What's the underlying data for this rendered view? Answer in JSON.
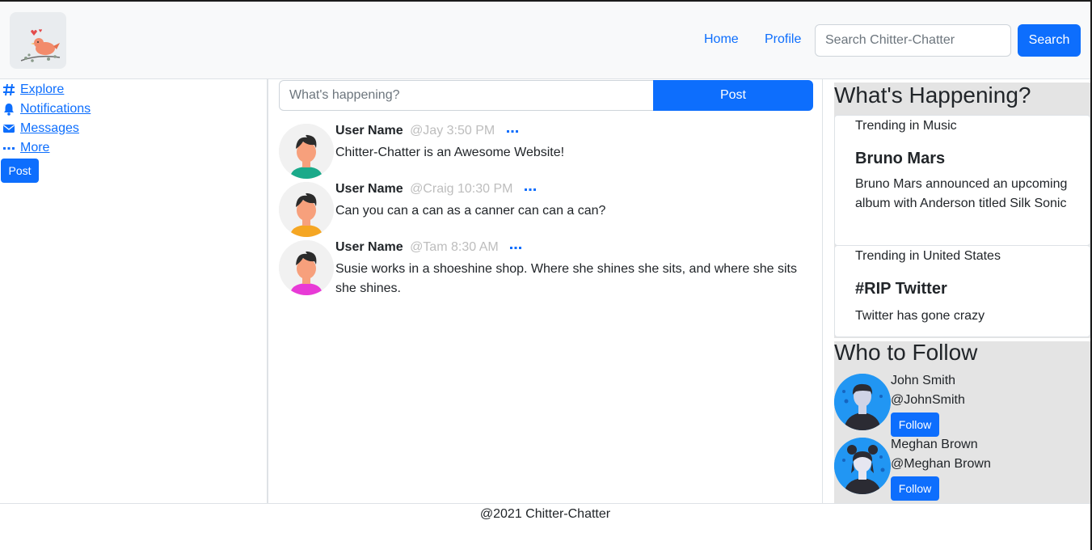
{
  "navbar": {
    "logo_icon": "bird-logo-icon",
    "links": [
      "Home",
      "Profile"
    ],
    "search_placeholder": "Search Chitter-Chatter",
    "search_button": "Search"
  },
  "sidebar": {
    "items": [
      {
        "label": "Explore",
        "icon": "hashtag-icon"
      },
      {
        "label": "Notifications",
        "icon": "bell-icon"
      },
      {
        "label": "Messages",
        "icon": "envelope-icon"
      },
      {
        "label": "More",
        "icon": "dots-icon"
      }
    ],
    "post_button": "Post"
  },
  "compose": {
    "placeholder": "What's happening?",
    "post_button": "Post"
  },
  "feed": [
    {
      "name": "User Name",
      "handle": "@Jay",
      "time": "3:50 PM",
      "text": "Chitter-Chatter is an Awesome Website!",
      "shirt_color": "#1aaa8a"
    },
    {
      "name": "User Name",
      "handle": "@Craig",
      "time": "10:30 PM",
      "text": "Can you can a can as a canner can can a can?",
      "shirt_color": "#f5a623"
    },
    {
      "name": "User Name",
      "handle": "@Tam",
      "time": "8:30 AM",
      "text": "Susie works in a shoeshine shop. Where she shines she sits, and where she sits she shines.",
      "shirt_color": "#e83ad6"
    }
  ],
  "happening": {
    "title": "What's Happening?",
    "trends": [
      {
        "category": "Trending in Music",
        "name": "Bruno Mars",
        "description": "Bruno Mars announced an upcoming album with Anderson titled Silk Sonic"
      },
      {
        "category": "Trending in United States",
        "name": "#RIP Twitter",
        "description": "Twitter has gone crazy"
      }
    ]
  },
  "who_to_follow": {
    "title": "Who to Follow",
    "users": [
      {
        "name": "John Smith",
        "handle": "@JohnSmith",
        "button": "Follow"
      },
      {
        "name": "Meghan Brown",
        "handle": "@Meghan Brown",
        "button": "Follow"
      }
    ]
  },
  "footer": {
    "text": "@2021 Chitter-Chatter"
  },
  "colors": {
    "accent": "#0d6efd",
    "panel_bg": "#e4e4e4",
    "navbar_bg": "#f8f9fa"
  }
}
